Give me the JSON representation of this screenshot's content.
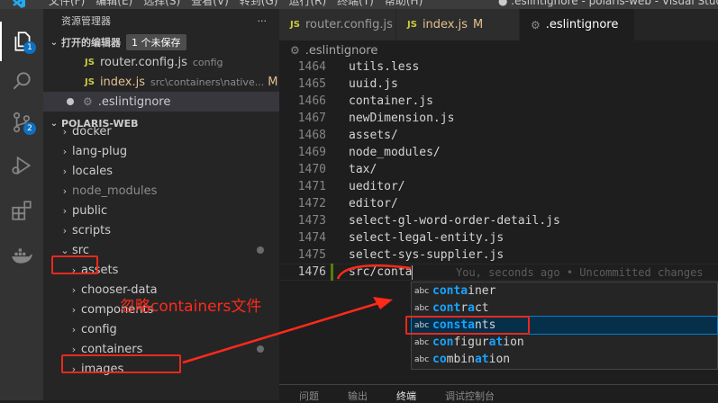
{
  "titlebar": {
    "menus": [
      "文件(F)",
      "编辑(E)",
      "选择(S)",
      "查看(V)",
      "转到(G)",
      "运行(R)",
      "终端(T)",
      "帮助(H)"
    ],
    "window_title": "● .eslintignore - polaris-web - Visual Studio Code"
  },
  "activity_bar": {
    "items": [
      {
        "icon": "files-icon",
        "badge": "1"
      },
      {
        "icon": "search-icon",
        "badge": ""
      },
      {
        "icon": "source-control-icon",
        "badge": "2"
      },
      {
        "icon": "run-debug-icon",
        "badge": ""
      },
      {
        "icon": "extensions-icon",
        "badge": ""
      },
      {
        "icon": "docker-icon",
        "badge": ""
      }
    ]
  },
  "sidebar": {
    "title": "资源管理器",
    "more": "···",
    "open_editors": {
      "label": "打开的编辑器",
      "unsaved_badge": "1 个未保存",
      "items": [
        {
          "icon": "JS",
          "name": "router.config.js",
          "desc": "config",
          "mod": ""
        },
        {
          "icon": "JS",
          "name": "index.js",
          "desc": "src\\containers\\native...",
          "mod": "M"
        },
        {
          "icon": "",
          "name": ".eslintignore",
          "desc": "",
          "mod": ""
        }
      ]
    },
    "project": {
      "label": "POLARIS-WEB",
      "tree": [
        "docker",
        "lang-plug",
        "locales",
        "node_modules",
        "public",
        "scripts",
        "src",
        "assets",
        "chooser-data",
        "components",
        "config",
        "containers",
        "images"
      ]
    }
  },
  "tabs": [
    {
      "icon": "JS",
      "label": "router.config.js",
      "mod": "",
      "active": false
    },
    {
      "icon": "JS",
      "label": "index.js",
      "mod": "M",
      "active": false
    },
    {
      "icon": "gear",
      "label": ".eslintignore",
      "mod": "dot",
      "active": true
    }
  ],
  "breadcrumb": ".eslintignore",
  "editor": {
    "lines": [
      {
        "n": "1464",
        "text": "utils.less"
      },
      {
        "n": "1465",
        "text": "uuid.js"
      },
      {
        "n": "1466",
        "text": "container.js"
      },
      {
        "n": "1467",
        "text": "newDimension.js"
      },
      {
        "n": "1468",
        "text": "assets/"
      },
      {
        "n": "1469",
        "text": "node_modules/"
      },
      {
        "n": "1470",
        "text": "tax/"
      },
      {
        "n": "1471",
        "text": "ueditor/"
      },
      {
        "n": "1472",
        "text": "editor/"
      },
      {
        "n": "1473",
        "text": "select-gl-word-order-detail.js"
      },
      {
        "n": "1474",
        "text": "select-legal-entity.js"
      },
      {
        "n": "1475",
        "text": "select-sys-supplier.js"
      },
      {
        "n": "1476",
        "text": "src/conta"
      }
    ],
    "blame": "You, seconds ago • Uncommitted changes"
  },
  "suggestions": {
    "kind_label": "abc",
    "items": [
      {
        "pre": "",
        "m1": "conta",
        "mid": "iner",
        "m2": "",
        "post": "",
        "selected": false
      },
      {
        "pre": "",
        "m1": "cont",
        "mid": "r",
        "m2": "a",
        "post": "ct",
        "selected": false
      },
      {
        "pre": "",
        "m1": "cons",
        "mid": "",
        "m2": "ta",
        "post": "nts",
        "selected": true
      },
      {
        "pre": "",
        "m1": "con",
        "mid": "figur",
        "m2": "at",
        "post": "ion",
        "selected": false
      },
      {
        "pre": "",
        "m1": "co",
        "mid": "mbin",
        "m2": "at",
        "post": "ion",
        "selected": false
      }
    ]
  },
  "panel_tabs": [
    "问题",
    "输出",
    "终端",
    "调试控制台"
  ],
  "panel_active": 2,
  "annotation": {
    "text": "忽略containers文件",
    "color": "#ff2a1a"
  }
}
